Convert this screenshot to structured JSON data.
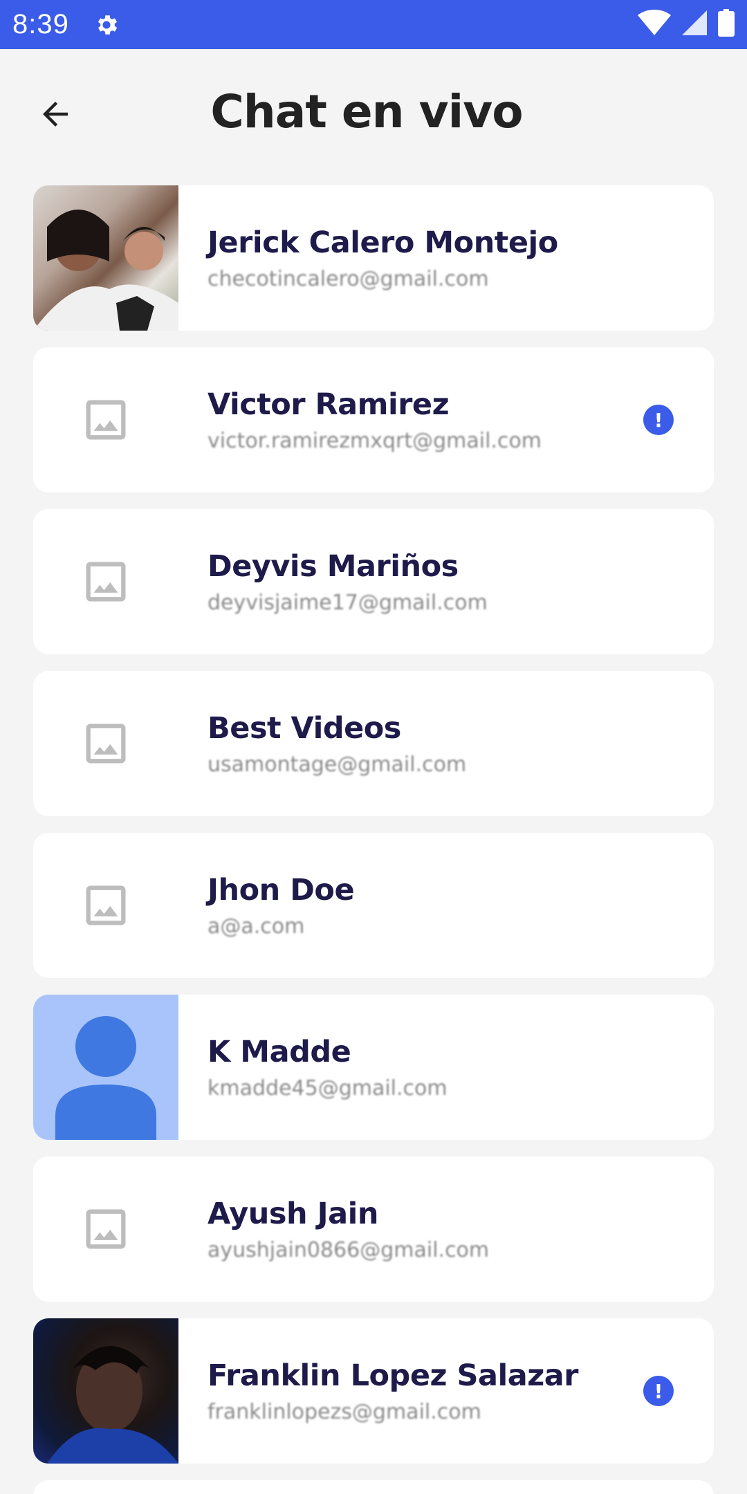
{
  "status_bar": {
    "time": "8:39",
    "icons": [
      "gear-icon",
      "wifi-icon",
      "signal-icon",
      "battery-icon"
    ],
    "color": "#3b5ce8"
  },
  "header": {
    "title": "Chat en vivo",
    "back_icon": "arrow-left-icon"
  },
  "contacts": [
    {
      "name": "Jerick Calero Montejo",
      "email": "checotincalero@gmail.com",
      "avatar": "photo",
      "alert": false
    },
    {
      "name": "Victor Ramirez",
      "email": "victor.ramirezmxqrt@gmail.com",
      "avatar": "image-placeholder-icon",
      "alert": true
    },
    {
      "name": "Deyvis Mariños",
      "email": "deyvisjaime17@gmail.com",
      "avatar": "image-placeholder-icon",
      "alert": false
    },
    {
      "name": "Best Videos",
      "email": "usamontage@gmail.com",
      "avatar": "image-placeholder-icon",
      "alert": false
    },
    {
      "name": "Jhon Doe",
      "email": "a@a.com",
      "avatar": "image-placeholder-icon",
      "alert": false
    },
    {
      "name": "K Madde",
      "email": "kmadde45@gmail.com",
      "avatar": "default-person-icon",
      "alert": false
    },
    {
      "name": "Ayush Jain",
      "email": "ayushjain0866@gmail.com",
      "avatar": "image-placeholder-icon",
      "alert": false
    },
    {
      "name": "Franklin Lopez Salazar",
      "email": "franklinlopezs@gmail.com",
      "avatar": "photo",
      "alert": true
    }
  ],
  "alert_badge": {
    "symbol": "!",
    "color": "#3b5ce8"
  }
}
